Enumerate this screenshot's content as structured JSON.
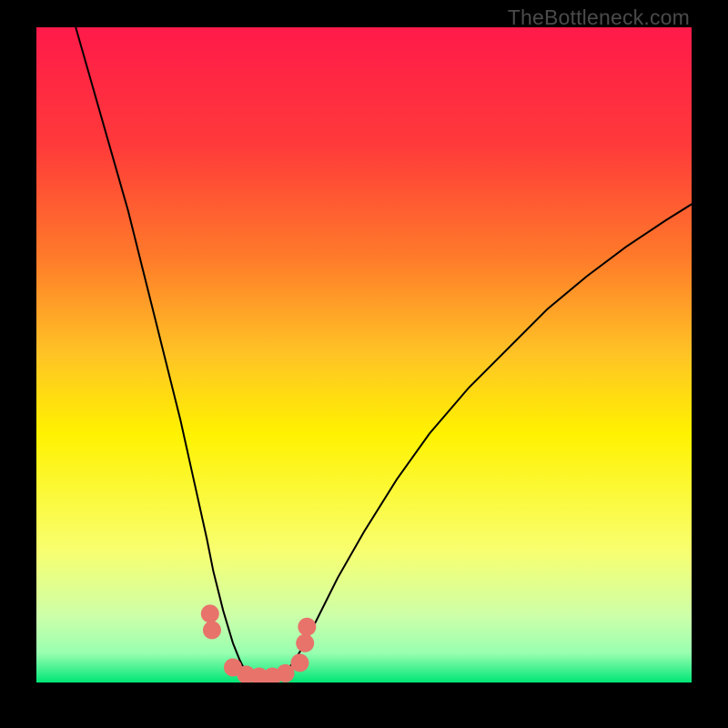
{
  "watermark": "TheBottleneck.com",
  "chart_data": {
    "type": "line",
    "title": "",
    "xlabel": "",
    "ylabel": "",
    "xlim": [
      0,
      100
    ],
    "ylim": [
      0,
      100
    ],
    "background_gradient": {
      "stops": [
        {
          "offset": 0.0,
          "color": "#ff1a4a"
        },
        {
          "offset": 0.18,
          "color": "#ff3a3a"
        },
        {
          "offset": 0.35,
          "color": "#ff7a2a"
        },
        {
          "offset": 0.5,
          "color": "#ffc425"
        },
        {
          "offset": 0.62,
          "color": "#fff200"
        },
        {
          "offset": 0.8,
          "color": "#f8ff70"
        },
        {
          "offset": 0.9,
          "color": "#ccffaa"
        },
        {
          "offset": 0.955,
          "color": "#98ffb0"
        },
        {
          "offset": 1.0,
          "color": "#00e676"
        }
      ]
    },
    "series": [
      {
        "name": "leg-left",
        "stroke": "#000000",
        "stroke_width": 2,
        "x": [
          6,
          8,
          10,
          12,
          14,
          16,
          18,
          20,
          22,
          24,
          26,
          27,
          28.5,
          30,
          31,
          32,
          33
        ],
        "y": [
          100,
          93,
          86,
          79,
          72,
          64,
          56,
          48,
          40,
          31,
          22,
          17,
          11,
          6,
          3.5,
          1.5,
          0.5
        ]
      },
      {
        "name": "leg-right",
        "stroke": "#000000",
        "stroke_width": 2,
        "x": [
          37,
          38,
          39.5,
          41,
          43,
          46,
          50,
          55,
          60,
          66,
          72,
          78,
          84,
          90,
          96,
          100
        ],
        "y": [
          0.5,
          1.5,
          3.5,
          6,
          10,
          16,
          23,
          31,
          38,
          45,
          51,
          57,
          62,
          66.5,
          70.5,
          73
        ]
      },
      {
        "name": "marker-series",
        "type": "scatter",
        "marker": {
          "shape": "circle",
          "radius": 10,
          "fill": "#e8736b"
        },
        "x": [
          26.5,
          26.8,
          30.0,
          32.0,
          34.0,
          36.0,
          38.0,
          40.2,
          41.0,
          41.3
        ],
        "y": [
          10.5,
          8.0,
          2.3,
          1.2,
          0.9,
          0.9,
          1.4,
          3.0,
          6.0,
          8.5
        ]
      }
    ]
  }
}
